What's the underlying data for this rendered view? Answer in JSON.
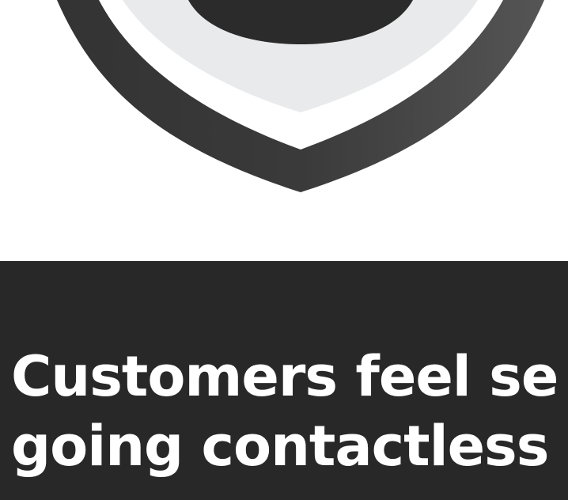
{
  "icon": {
    "name": "shield-icon",
    "colors": {
      "outer": "#4f4f4f",
      "outer_dark": "#333333",
      "gap": "#ffffff",
      "inner": "#e9eaec",
      "core": "#2b2b2b"
    }
  },
  "banner": {
    "background": "#282828",
    "headline_line1": "Customers feel se",
    "headline_line2": "going contactless"
  }
}
